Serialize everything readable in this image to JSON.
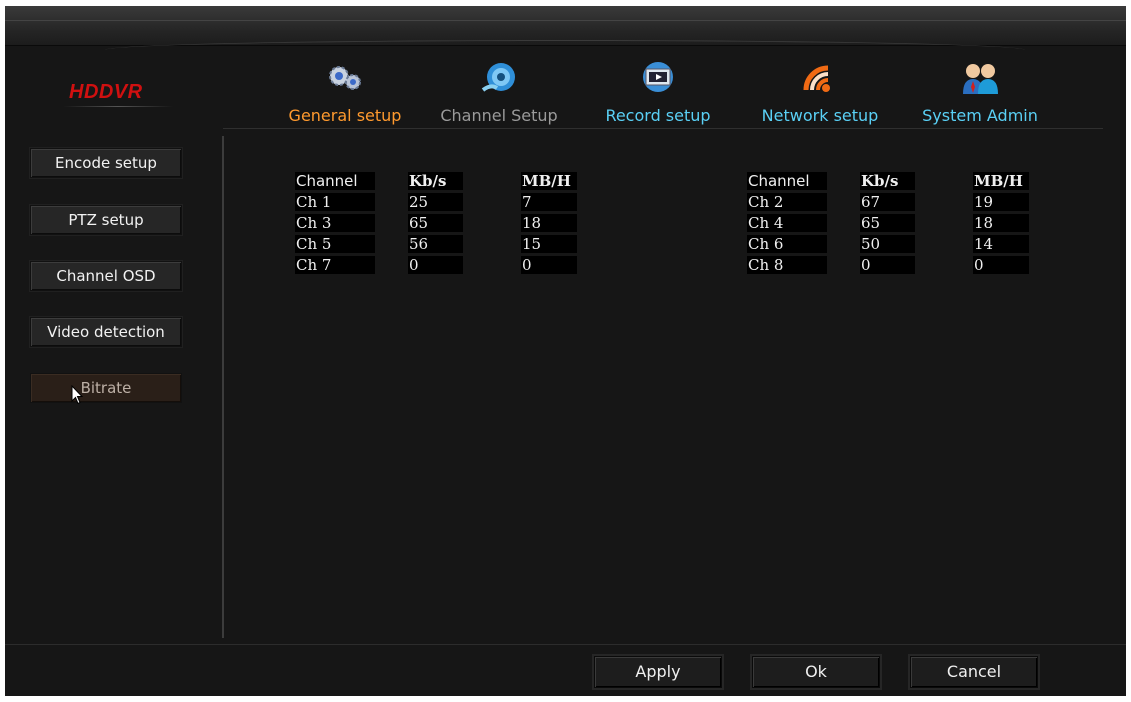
{
  "app": {
    "logo": "HDDVR"
  },
  "tabs": [
    {
      "label": "General setup",
      "icon": "gears-icon",
      "color": "#ff9a2e"
    },
    {
      "label": "Channel Setup",
      "icon": "camera-icon",
      "color": "#9a9a9a"
    },
    {
      "label": "Record setup",
      "icon": "film-icon",
      "color": "#5ad0f5"
    },
    {
      "label": "Network setup",
      "icon": "wifi-icon",
      "color": "#5ad0f5"
    },
    {
      "label": "System Admin",
      "icon": "users-icon",
      "color": "#5ad0f5"
    }
  ],
  "sidebar": {
    "items": [
      {
        "label": "Encode setup"
      },
      {
        "label": "PTZ setup"
      },
      {
        "label": "Channel OSD"
      },
      {
        "label": "Video detection"
      },
      {
        "label": "Bitrate",
        "active": true
      }
    ]
  },
  "bitrate_table": {
    "headers": [
      "Channel",
      "Kb/s",
      "MB/H"
    ],
    "left": [
      {
        "channel": "Ch 1",
        "kbps": "25",
        "mbh": "7"
      },
      {
        "channel": "Ch 3",
        "kbps": "65",
        "mbh": "18"
      },
      {
        "channel": "Ch 5",
        "kbps": "56",
        "mbh": "15"
      },
      {
        "channel": "Ch 7",
        "kbps": "0",
        "mbh": "0"
      }
    ],
    "right": [
      {
        "channel": "Ch 2",
        "kbps": "67",
        "mbh": "19"
      },
      {
        "channel": "Ch 4",
        "kbps": "65",
        "mbh": "18"
      },
      {
        "channel": "Ch 6",
        "kbps": "50",
        "mbh": "14"
      },
      {
        "channel": "Ch 8",
        "kbps": "0",
        "mbh": "0"
      }
    ]
  },
  "footer": {
    "apply": "Apply",
    "ok": "Ok",
    "cancel": "Cancel"
  }
}
